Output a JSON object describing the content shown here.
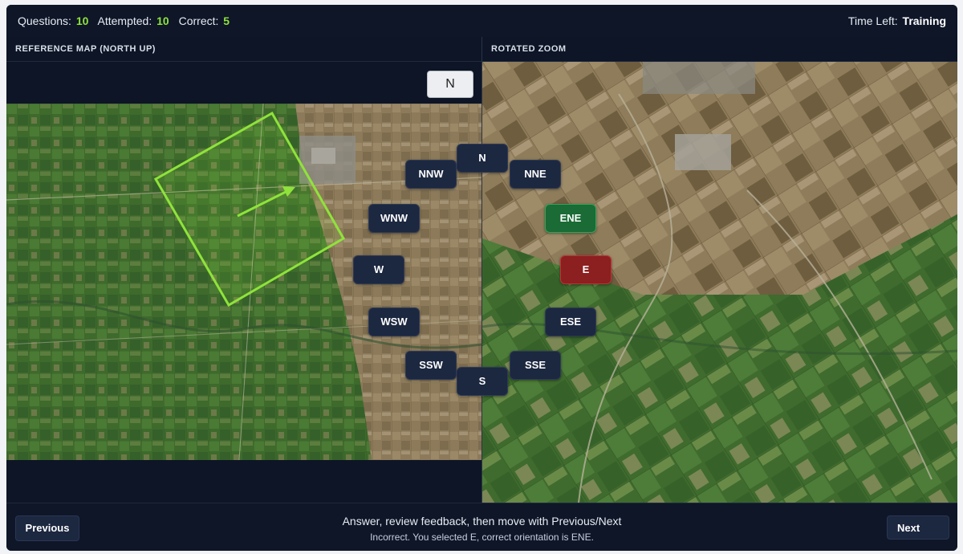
{
  "header": {
    "questions_label": "Questions:",
    "questions_value": "10",
    "attempted_label": "Attempted:",
    "attempted_value": "10",
    "correct_label": "Correct:",
    "correct_value": "5",
    "time_left_label": "Time Left:",
    "time_left_value": "Training"
  },
  "left_panel": {
    "title": "REFERENCE MAP (NORTH UP)",
    "north_button": "N"
  },
  "right_panel": {
    "title": "ROTATED ZOOM"
  },
  "compass": {
    "N": "N",
    "NNE": "NNE",
    "ENE": "ENE",
    "E": "E",
    "ESE": "ESE",
    "SSE": "SSE",
    "S": "S",
    "SSW": "SSW",
    "WSW": "WSW",
    "W": "W",
    "WNW": "WNW",
    "NNW": "NNW",
    "correct_choice": "ENE",
    "selected_choice": "E"
  },
  "footer": {
    "previous": "Previous",
    "next": "Next",
    "instruction": "Answer, review feedback, then move with Previous/Next",
    "feedback": "Incorrect. You selected E, correct orientation is ENE."
  },
  "colors": {
    "accent_green": "#8fe33a",
    "correct_fill": "#1a6b35",
    "wrong_fill": "#8c1f1f",
    "panel_bg": "#0d1526"
  }
}
